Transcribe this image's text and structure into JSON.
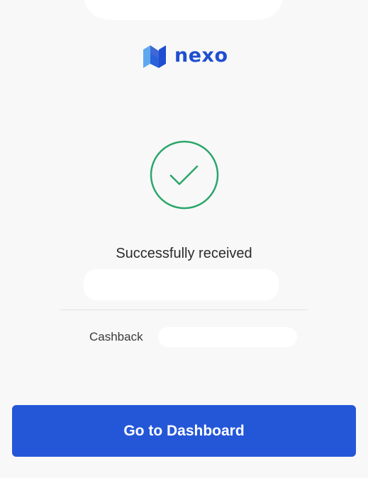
{
  "brand": {
    "name": "nexo",
    "logo_icon": "nexo-logo-icon",
    "color": "#1f4fd0"
  },
  "status": {
    "icon": "checkmark-circle-icon",
    "color": "#2aa66a",
    "title": "Successfully received"
  },
  "details": {
    "cashback_label": "Cashback"
  },
  "actions": {
    "primary_label": "Go to Dashboard",
    "primary_color": "#2457d8"
  }
}
